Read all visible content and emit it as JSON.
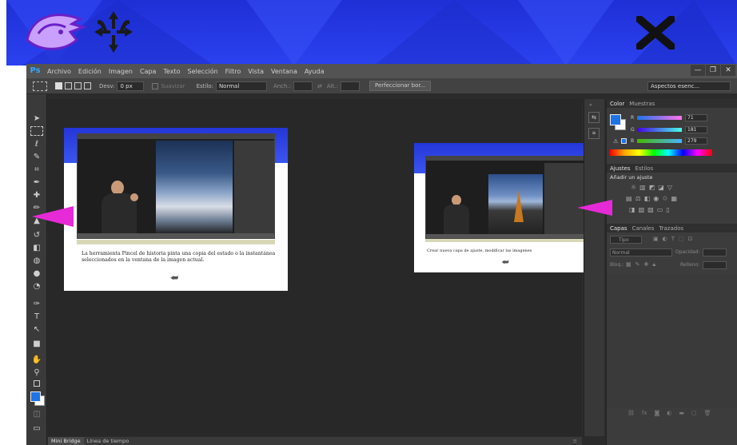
{
  "menu": {
    "app_icon": "Ps",
    "items": [
      "Archivo",
      "Edición",
      "Imagen",
      "Capa",
      "Texto",
      "Selección",
      "Filtro",
      "Vista",
      "Ventana",
      "Ayuda"
    ]
  },
  "window_controls": {
    "minimize": "—",
    "restore": "❐",
    "close": "✕"
  },
  "options_bar": {
    "desv_label": "Desv:",
    "desv_value": "0 px",
    "suavizar_label": "Suavizar",
    "estilo_label": "Estilo:",
    "estilo_value": "Normal",
    "anch_label": "Anch.:",
    "alt_label": "Alt.:",
    "refine_button": "Perfeccionar bor...",
    "workspace": "Aspectos esenc..."
  },
  "left_tutorial": {
    "caption": "La herramienta Pincel de historia pinta una copia del estado o la instantánea seleccionados en la ventana de la imagen actual."
  },
  "right_tutorial": {
    "caption": "Crear nueva capa de ajuste, modificar las imagenes"
  },
  "color_panel": {
    "tabs": [
      "Color",
      "Muestras"
    ],
    "r_label": "R",
    "r_value": "71",
    "g_label": "G",
    "g_value": "181",
    "b_label": "B",
    "b_value": "279"
  },
  "adjustments_panel": {
    "tabs": [
      "Ajustes",
      "Estilos"
    ],
    "heading": "Añadir un ajuste"
  },
  "layers_panel": {
    "tabs": [
      "Capas",
      "Canales",
      "Trazados"
    ],
    "kind_label": "Tipo",
    "blend_value": "Normal",
    "opacity_label": "Opacidad:",
    "lock_label": "Bloq.:",
    "fill_label": "Relleno:"
  },
  "status_bar": {
    "tabs": [
      "Mini Bridge",
      "Línea de tiempo"
    ]
  },
  "colors": {
    "banner": "#2638e0",
    "arrow": "#e62ad8",
    "ps_blue": "#31a8ff",
    "fg_swatch": "#1e73e8"
  }
}
